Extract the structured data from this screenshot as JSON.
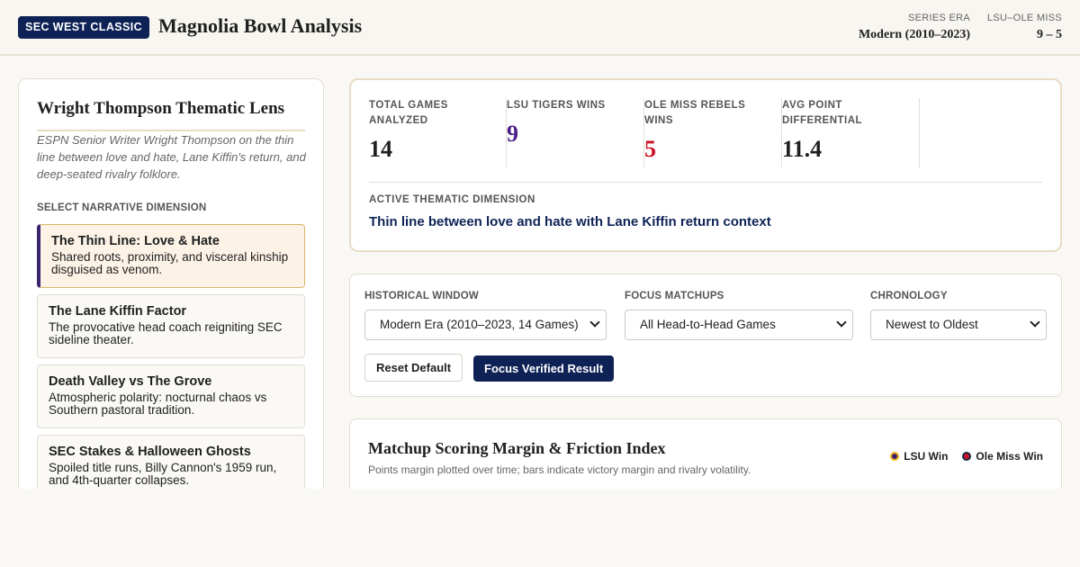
{
  "header": {
    "badge": "SEC WEST CLASSIC",
    "title": "Magnolia Bowl Analysis",
    "era_label": "SERIES ERA",
    "era_value": "Modern (2010–2023)",
    "record_label": "LSU–OLE MISS",
    "record_value": "9 – 5"
  },
  "sidebar": {
    "title": "Wright Thompson Thematic Lens",
    "description": "ESPN Senior Writer Wright Thompson on the thin line between love and hate, Lane Kiffin's return, and deep-seated rivalry folklore.",
    "select_label": "SELECT NARRATIVE DIMENSION",
    "dimensions": [
      {
        "title": "The Thin Line: Love & Hate",
        "desc": "Shared roots, proximity, and visceral kinship disguised as venom.",
        "active": true
      },
      {
        "title": "The Lane Kiffin Factor",
        "desc": "The provocative head coach reigniting SEC sideline theater.",
        "active": false
      },
      {
        "title": "Death Valley vs The Grove",
        "desc": "Atmospheric polarity: nocturnal chaos vs Southern pastoral tradition.",
        "active": false
      },
      {
        "title": "SEC Stakes & Halloween Ghosts",
        "desc": "Spoiled title runs, Billy Cannon's 1959 run, and 4th-quarter collapses.",
        "active": false
      }
    ]
  },
  "stats": {
    "items": [
      {
        "label": "TOTAL GAMES ANALYZED",
        "value": "14",
        "color": "#1f1f1f"
      },
      {
        "label": "LSU TIGERS WINS",
        "value": "9",
        "color": "#4a1f8a"
      },
      {
        "label": "OLE MISS REBELS WINS",
        "value": "5",
        "color": "#ce1126"
      },
      {
        "label": "AVG POINT DIFFERENTIAL",
        "value": "11.4",
        "color": "#1f1f1f"
      }
    ],
    "theme_label": "ACTIVE THEMATIC DIMENSION",
    "theme_value": "Thin line between love and hate with Lane Kiffin return context"
  },
  "filters": {
    "window_label": "HISTORICAL WINDOW",
    "window_value": "Modern Era (2010–2023, 14 Games)",
    "matchups_label": "FOCUS MATCHUPS",
    "matchups_value": "All Head-to-Head Games",
    "chronology_label": "CHRONOLOGY",
    "chronology_value": "Newest to Oldest",
    "reset_label": "Reset Default",
    "focus_label": "Focus Verified Result"
  },
  "chart": {
    "title": "Matchup Scoring Margin & Friction Index",
    "subtitle": "Points margin plotted over time; bars indicate victory margin and rivalry volatility.",
    "legend_lsu": "LSU Win",
    "legend_om": "Ole Miss Win"
  },
  "colors": {
    "navy": "#0e2256",
    "lsu_purple": "#4a1f8a",
    "lsu_gold": "#f2b51c",
    "ole_miss_red": "#ce1126"
  }
}
